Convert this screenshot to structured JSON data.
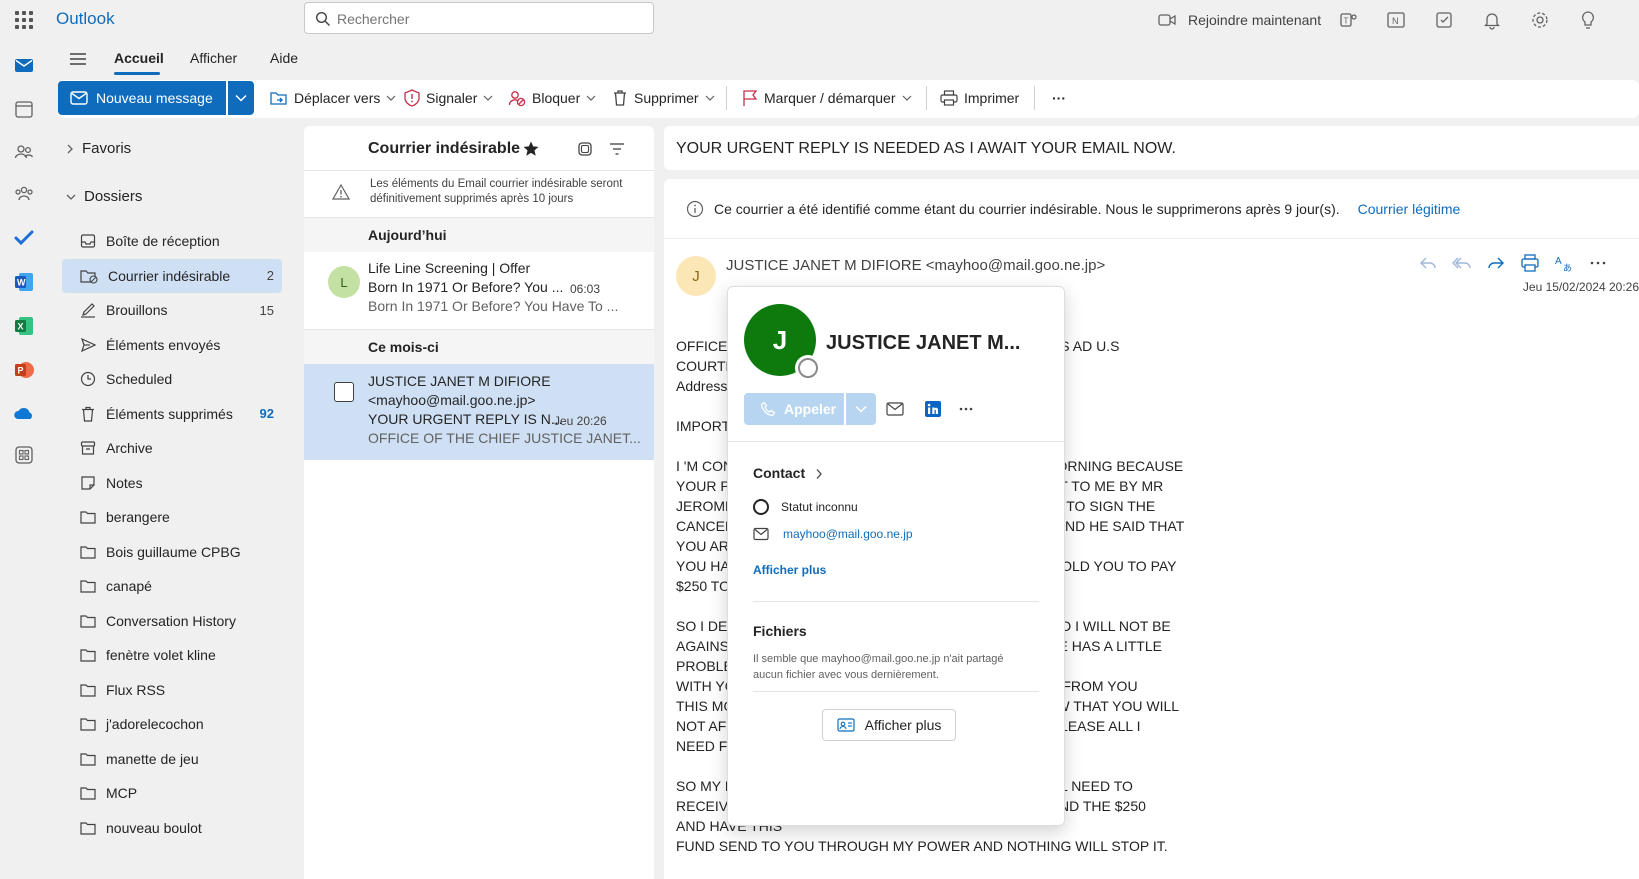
{
  "app": {
    "name": "Outlook"
  },
  "search": {
    "placeholder": "Rechercher"
  },
  "topbar": {
    "join_label": "Rejoindre maintenant"
  },
  "ribbon": {
    "tabs": [
      "Accueil",
      "Afficher",
      "Aide"
    ]
  },
  "toolbar": {
    "new_message": "Nouveau message",
    "move_to": "Déplacer vers",
    "report": "Signaler",
    "block": "Bloquer",
    "delete": "Supprimer",
    "flag": "Marquer / démarquer",
    "print": "Imprimer",
    "more": "···"
  },
  "folders": {
    "favorites": "Favoris",
    "folders_header": "Dossiers",
    "items": [
      {
        "label": "Boîte de réception",
        "count": "",
        "icon": "inbox-icon"
      },
      {
        "label": "Courrier indésirable",
        "count": "2",
        "icon": "junk-icon",
        "selected": true
      },
      {
        "label": "Brouillons",
        "count": "15",
        "icon": "draft-icon"
      },
      {
        "label": "Éléments envoyés",
        "count": "",
        "icon": "send-icon"
      },
      {
        "label": "Scheduled",
        "count": "",
        "icon": "clock-icon"
      },
      {
        "label": "Éléments supprimés",
        "count": "92",
        "icon": "trash-icon"
      },
      {
        "label": "Archive",
        "count": "",
        "icon": "archive-icon"
      },
      {
        "label": "Notes",
        "count": "",
        "icon": "note-icon"
      },
      {
        "label": "berangere",
        "count": "",
        "icon": "folder-icon"
      },
      {
        "label": "Bois guillaume CPBG",
        "count": "",
        "icon": "folder-icon"
      },
      {
        "label": "canapé",
        "count": "",
        "icon": "folder-icon"
      },
      {
        "label": "Conversation History",
        "count": "",
        "icon": "folder-icon"
      },
      {
        "label": "fenètre volet kline",
        "count": "",
        "icon": "folder-icon"
      },
      {
        "label": "Flux RSS",
        "count": "",
        "icon": "folder-icon"
      },
      {
        "label": "j'adorelecochon",
        "count": "",
        "icon": "folder-icon"
      },
      {
        "label": "manette de jeu",
        "count": "",
        "icon": "folder-icon"
      },
      {
        "label": "MCP",
        "count": "",
        "icon": "folder-icon"
      },
      {
        "label": "nouveau boulot",
        "count": "",
        "icon": "folder-icon"
      }
    ]
  },
  "message_list": {
    "title": "Courrier indésirable",
    "notice": "Les éléments du Email courrier indésirable seront définitivement supprimés après 10 jours",
    "section_today": "Aujourd’hui",
    "section_month": "Ce mois-ci",
    "mails": [
      {
        "avatar": "L",
        "sender": "Life Line Screening | Offer",
        "subject": "Born In 1971 Or Before? You ...",
        "time": "06:03",
        "preview": "Born In 1971 Or Before? You Have To ..."
      },
      {
        "sender": "JUSTICE JANET M DIFIORE",
        "sender2": "<mayhoo@mail.goo.ne.jp>",
        "subject": "YOUR URGENT REPLY IS N...",
        "time": "Jeu 20:26",
        "preview": "OFFICE OF THE CHIEF JUSTICE JANET..."
      }
    ]
  },
  "reading": {
    "subject": "YOUR URGENT REPLY IS NEEDED AS I AWAIT YOUR EMAIL NOW.",
    "banner": "Ce courrier a été identifié comme étant du courrier indésirable. Nous le supprimerons après 9 jour(s).",
    "banner_link": "Courrier légitime",
    "avatar": "J",
    "from": "JUSTICE JANET M DIFIORE <mayhoo@mail.goo.ne.jp>",
    "date": "Jeu 15/02/2024 20:26",
    "body": "OFFICE                                                                       UILDINGS AD U.S\nCOURTH\nAddress\n\nIMPORT                                                                          ON,\n\nI 'M CON                                                                       THIS MORNING BECAUSE\nYOUR PA                                                                        OUGHT TO ME BY MR\nJEROME                                                                         ED ME TO SIGN THE\nCANCEL                                                                          WHY AND HE SAID THAT\nYOU AR\nYOU HA                                                                           HEY TOLD YOU TO PAY\n$250 TO\n\nSO I DEC                                                                          W AND I WILL NOT BE\nAGAINS                                                                          YBE HE HAS A LITTLE\nPROBLE\nWITH YO                                                                         HEAR FROM YOU\nTHIS MO                                                                         I KNOW THAT YOU WILL\nNOT AFI                                                                          AND PLEASE ALL I\nNEED FR\n\nSO MY I                                                                          U STILL NEED TO\nRECEIVE                                                                         LL SEND THE $250\nAND HAVE THIS\nFUND SEND TO YOU THROUGH MY POWER AND NOTHING WILL STOP IT."
  },
  "contact_card": {
    "avatar": "J",
    "name": "JUSTICE JANET M...",
    "call": "Appeler",
    "contact_header": "Contact",
    "status": "Statut inconnu",
    "email": "mayhoo@mail.goo.ne.jp",
    "show_more_link": "Afficher plus",
    "files_header": "Fichiers",
    "files_desc": "Il semble que mayhoo@mail.goo.ne.jp n'ait partagé aucun fichier avec vous dernièrement.",
    "show_more_button": "Afficher plus"
  },
  "colors": {
    "accent": "#0f6cbd",
    "selected": "#cfe0f5",
    "avatar_green": "#0e7a0d"
  }
}
